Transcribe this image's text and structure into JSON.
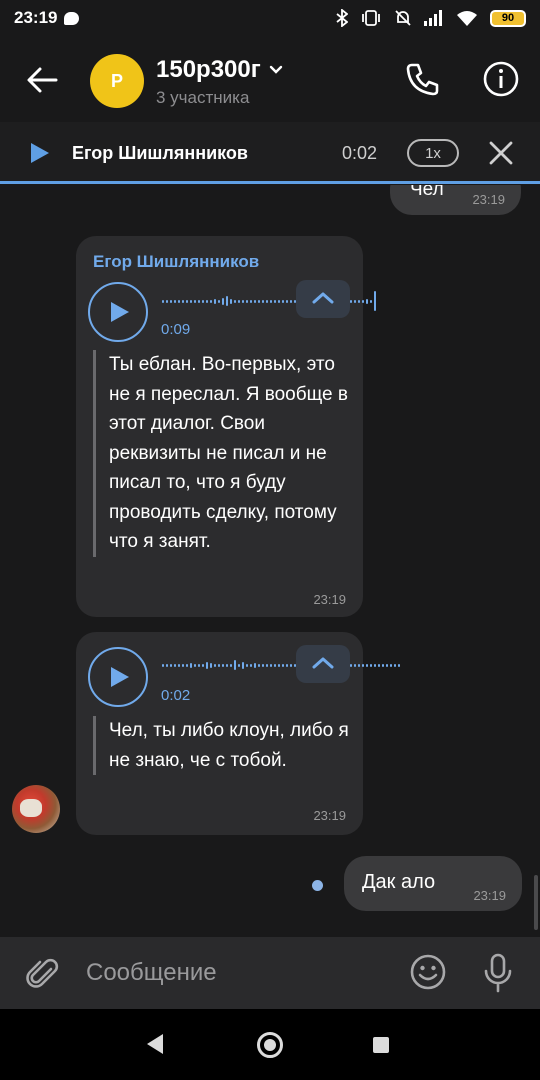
{
  "status_bar": {
    "time": "23:19",
    "battery": "90"
  },
  "header": {
    "title": "150р300г",
    "subtitle": "3 участника",
    "avatar_letter": "Р",
    "avatar_color": "#f0c418"
  },
  "player": {
    "sender": "Егор Шишлянников",
    "time": "0:02",
    "speed": "1x"
  },
  "messages": {
    "prev_out": {
      "text": "Чел",
      "time": "23:19"
    },
    "voice1": {
      "sender": "Егор Шишлянников",
      "duration": "0:09",
      "transcript": "Ты еблан. Во-первых, это не я переслал. Я вообще в этот диалог. Свои реквизиты не писал и не писал то, что я буду проводить сделку, потому что я занят.",
      "time": "23:19"
    },
    "voice2": {
      "duration": "0:02",
      "transcript": "Чел, ты либо клоун, либо я не знаю, че с тобой.",
      "time": "23:19"
    },
    "last_out": {
      "text": "Дак ало",
      "time": "23:19"
    }
  },
  "input": {
    "placeholder": "Сообщение"
  },
  "colors": {
    "accent": "#71aaeb",
    "background": "#19191a",
    "bubble_in": "#2c2c2e",
    "bubble_out": "#3a3a3c"
  }
}
